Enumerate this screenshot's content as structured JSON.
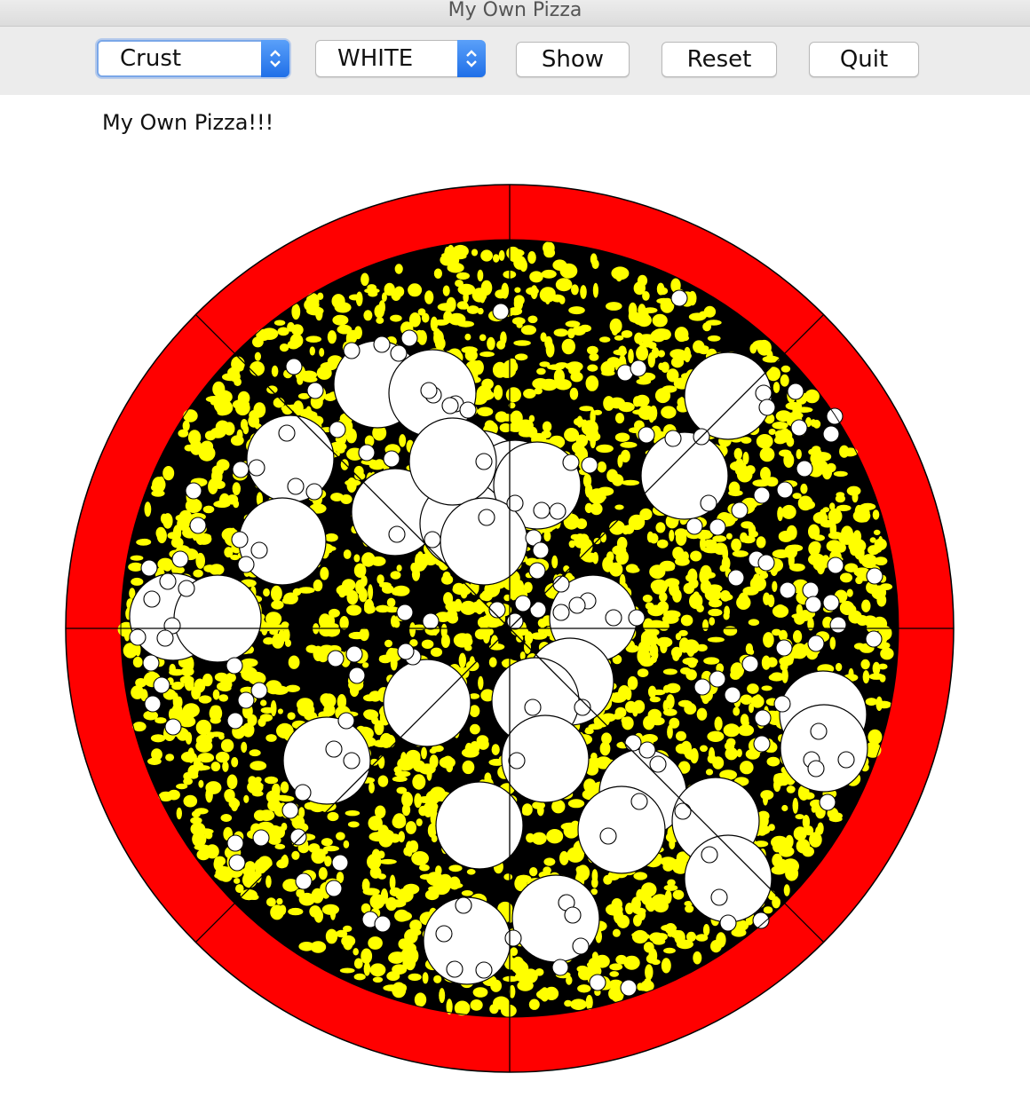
{
  "window": {
    "title": "My Own Pizza"
  },
  "toolbar": {
    "topping_select": {
      "value": "Crust"
    },
    "color_select": {
      "value": "WHITE"
    },
    "show_label": "Show",
    "reset_label": "Reset",
    "quit_label": "Quit"
  },
  "canvas": {
    "heading": "My Own Pizza!!!",
    "colors": {
      "crust": "#ff0000",
      "sauce": "#000000",
      "cheese": "#ffff00",
      "topping": "#ffffff",
      "outline": "#000000"
    },
    "slices": 8
  }
}
